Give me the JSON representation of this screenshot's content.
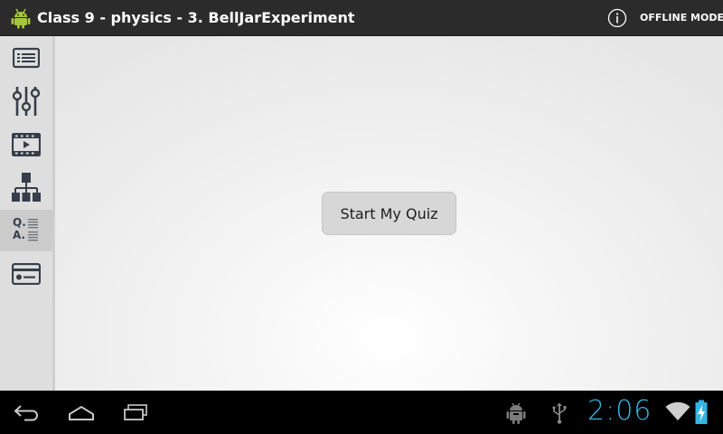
{
  "actionbar": {
    "app_icon": "android-robot-icon",
    "title": "Class 9 - physics - 3. BellJarExperiment",
    "info_icon": "info-circle-icon",
    "offline_label": "OFFLINE MODE"
  },
  "sidebar": {
    "items": [
      {
        "icon": "list-icon",
        "active": false
      },
      {
        "icon": "sliders-icon",
        "active": false
      },
      {
        "icon": "video-film-icon",
        "active": false
      },
      {
        "icon": "hierarchy-chart-icon",
        "active": false
      },
      {
        "icon": "qa-icon",
        "active": true
      },
      {
        "icon": "flashcard-icon",
        "active": false
      }
    ],
    "qa_q": "Q.",
    "qa_a": "A."
  },
  "main": {
    "start_button_label": "Start My Quiz"
  },
  "navbar": {
    "back_icon": "back-arrow-icon",
    "home_icon": "home-icon",
    "recents_icon": "recent-apps-icon",
    "status_icons": [
      "android-debug-icon",
      "usb-icon",
      "wifi-icon",
      "battery-charging-icon"
    ],
    "time": "2:06"
  },
  "colors": {
    "actionbar": "#2b2b2b",
    "sidebar": "#dedede",
    "clock": "#33b5e5",
    "button": "#d7d7d7"
  }
}
